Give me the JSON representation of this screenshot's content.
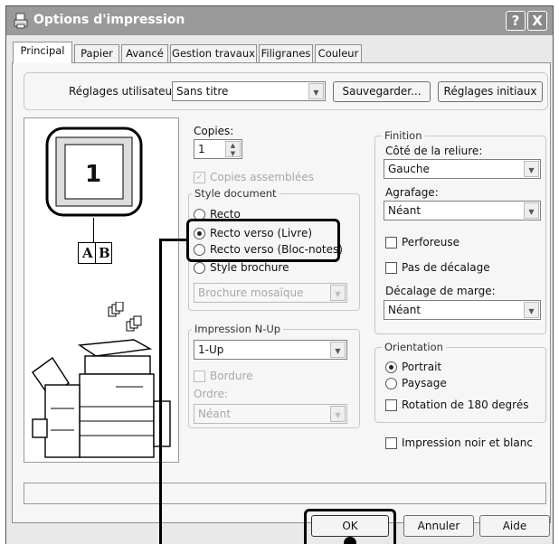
{
  "window": {
    "title": "Options d'impression",
    "help_glyph": "?",
    "close_glyph": "X"
  },
  "tabs": [
    "Principal",
    "Papier",
    "Avancé",
    "Gestion travaux",
    "Filigranes",
    "Couleur"
  ],
  "user_settings": {
    "label": "Réglages utilisateur:",
    "value": "Sans titre",
    "save": "Sauvegarder...",
    "defaults": "Réglages initiaux"
  },
  "preview": {
    "page_number": "1",
    "binding_left": "A",
    "binding_right": "B"
  },
  "copies": {
    "label": "Copies:",
    "value": "1",
    "collate": "Copies assemblées",
    "collate_checked": true
  },
  "document_style": {
    "label": "Style document",
    "options": [
      "Recto",
      "Recto verso (Livre)",
      "Recto verso (Bloc-notes)",
      "Style brochure"
    ],
    "selected": "Recto verso (Livre)",
    "booklet_value": "Brochure mosaïque"
  },
  "nup": {
    "label": "Impression N-Up",
    "value": "1-Up",
    "border": "Bordure",
    "order_label": "Ordre:",
    "order_value": "Néant"
  },
  "finishing": {
    "label": "Finition",
    "binding_edge_label": "Côté de la reliure:",
    "binding_edge": "Gauche",
    "staple_label": "Agrafage:",
    "staple": "Néant",
    "punch": "Perforeuse",
    "no_offset": "Pas de décalage",
    "margin_shift_label": "Décalage de marge:",
    "margin_shift": "Néant"
  },
  "orientation": {
    "label": "Orientation",
    "portrait": "Portrait",
    "landscape": "Paysage",
    "selected": "Portrait",
    "rotate": "Rotation de 180 degrés"
  },
  "bw_print": "Impression noir et blanc",
  "buttons": {
    "ok": "OK",
    "cancel": "Annuler",
    "help": "Aide"
  },
  "colors": {
    "titlebar": "#9a9a9a",
    "highlight": "#000000"
  }
}
